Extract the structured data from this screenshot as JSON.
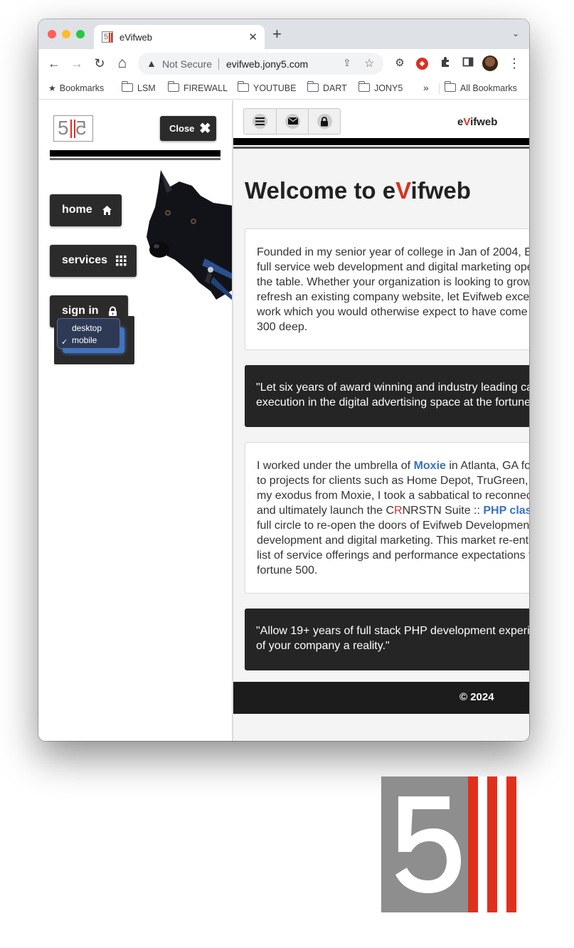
{
  "browser": {
    "tab_title": "eVifweb",
    "tab_close": "✕",
    "new_tab": "+",
    "tab_menu": "⌄",
    "nav": {
      "back": "←",
      "forward": "→",
      "reload": "↻",
      "home": "⌂"
    },
    "security_icon": "▲",
    "security_label": "Not Secure",
    "url": "evifweb.jony5.com",
    "share_icon": "⇪",
    "star_icon": "☆",
    "extensions": [
      "gear-icon",
      "ublock-icon",
      "puzzle-icon",
      "sidepanel-icon"
    ],
    "menu_icon": "⋮",
    "bookmarks": {
      "label": "Bookmarks",
      "folders": [
        "LSM",
        "FIREWALL",
        "YOUTUBE",
        "DART",
        "JONY5"
      ],
      "overflow": "»",
      "all_label": "All Bookmarks"
    }
  },
  "sidebar": {
    "logo_text": "5",
    "close_label": "Close",
    "close_icon": "✖",
    "nav": [
      {
        "label": "home",
        "icon": "house-icon"
      },
      {
        "label": "services",
        "icon": "grid-icon"
      },
      {
        "label": "sign in",
        "icon": "lock-icon"
      }
    ],
    "view_options": [
      "desktop",
      "mobile"
    ],
    "view_selected": "mobile",
    "check_mark": "✓"
  },
  "main": {
    "header_icons": [
      "menu-icon",
      "mail-icon",
      "lock-icon"
    ],
    "brand": {
      "pre": "e",
      "accent": "V",
      "post": "ifweb"
    },
    "welcome": {
      "pre": "Welcome to e",
      "accent": "V",
      "post": "ifweb"
    },
    "intro_lines": [
      "Founded in my senior year of college in Jan of 2004, E",
      "full service web development and digital marketing ope",
      "the table. Whether your organization is looking to grow",
      "refresh an existing company website, let Evifweb excee",
      "work which you would otherwise expect to have come",
      "300 deep."
    ],
    "quote1_lines": [
      "\"Let six years of award winning and industry leading ca",
      "execution in the digital advertising space at the fortune"
    ],
    "story": {
      "l1_pre": "I worked under the umbrella of ",
      "l1_link": "Moxie",
      "l1_post": " in Atlanta, GA fo",
      "l2": "to projects for clients such as Home Depot, TruGreen,",
      "l3": "my exodus from Moxie, I took a sabbatical to reconnec",
      "l4_pre": "and ultimately launch the C",
      "l4_accent": "R",
      "l4_mid": "NRSTN Suite :: ",
      "l4_link": "PHP clas",
      "l5": "full circle to re-open the doors of Evifweb Development",
      "l6": "development and digital marketing. This market re-entr",
      "l7": "list of service offerings and performance expectations t",
      "l8": "fortune 500."
    },
    "quote2_lines": [
      "\"Allow 19+ years of full stack PHP development experi",
      "of your company a reality.\""
    ],
    "footer": "© 2024"
  },
  "colors": {
    "accent_red": "#d8311f",
    "link_blue": "#3b73b9",
    "dark_panel": "#252525",
    "select_blue": "#3f73c4"
  }
}
